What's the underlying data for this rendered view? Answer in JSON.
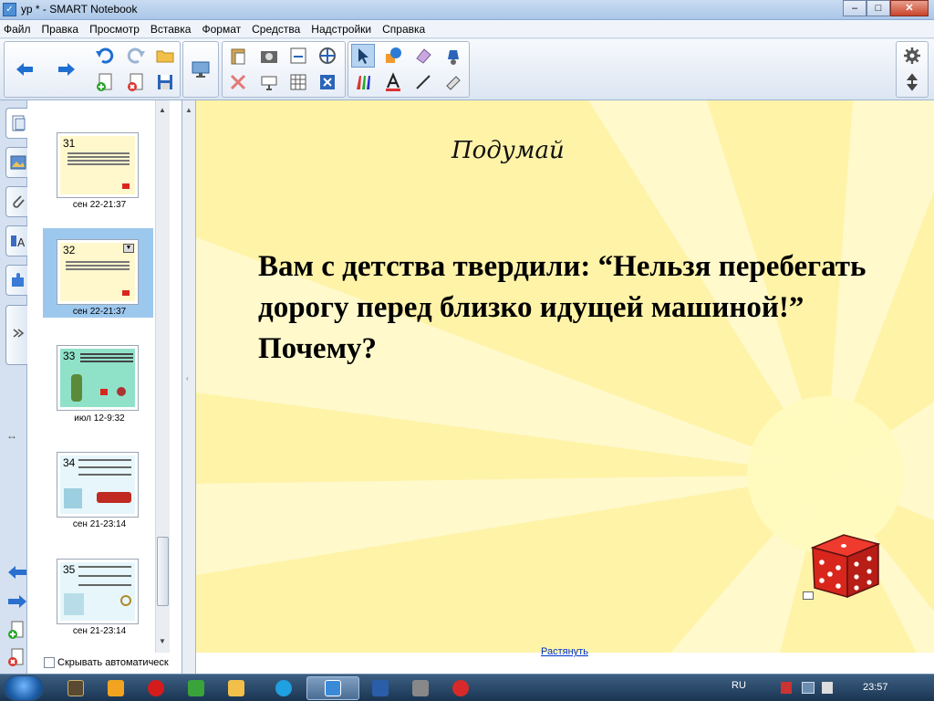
{
  "window": {
    "title": "ур * - SMART Notebook",
    "buttons": [
      "–",
      "□",
      "✕"
    ]
  },
  "menu": [
    "Файл",
    "Правка",
    "Просмотр",
    "Вставка",
    "Формат",
    "Средства",
    "Надстройки",
    "Справка"
  ],
  "sorter": {
    "pages": [
      {
        "num": "31",
        "label": "сен 22-21:37"
      },
      {
        "num": "32",
        "label": "сен 22-21:37"
      },
      {
        "num": "33",
        "label": "июл 12-9:32"
      },
      {
        "num": "34",
        "label": "сен 21-23:14"
      },
      {
        "num": "35",
        "label": "сен 21-23:14"
      }
    ],
    "selected_page": "32",
    "autohide_label": "Скрывать автоматическ"
  },
  "slide": {
    "heading": "Подумай",
    "question": "Вам с детства твердили: “Нельзя перебегать дорогу перед близко идущей машиной!” Почему?",
    "stretch_link": "Растянуть"
  },
  "colors": {
    "slide_bg": "#fff3a8",
    "ray": "#fff9c8",
    "selection": "#9dc8ee",
    "dice": "#d9261c"
  },
  "taskbar": {
    "lang": "RU",
    "clock": "23:57"
  }
}
